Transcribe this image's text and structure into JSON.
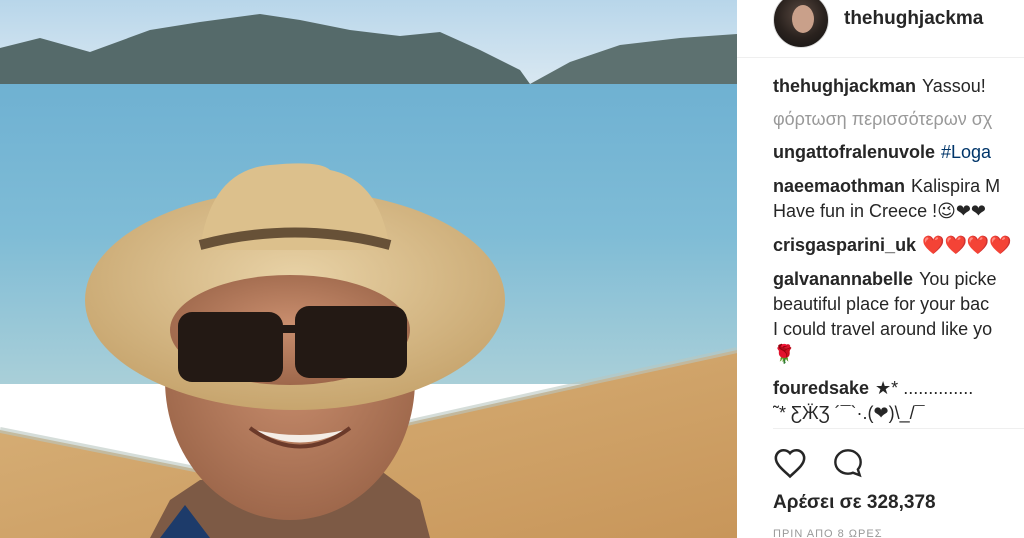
{
  "post": {
    "username": "thehughjackma",
    "photo_description_icon": "selfie-photo"
  },
  "caption": {
    "user": "thehughjackman",
    "text": "Yassou!"
  },
  "load_more": "φόρτωση περισσότερων σχ",
  "comments": [
    {
      "user": "ungattofralenuvole",
      "text": "#Loga"
    },
    {
      "user": "naeemaothman",
      "text": "Kalispira M",
      "line2": "Have fun in Creece !😉❤❤"
    },
    {
      "user": "crisgasparini_uk",
      "text": "❤️❤️❤️❤️"
    },
    {
      "user": "galvanannabelle",
      "text": "You picke",
      "line2": "beautiful place for your bac",
      "line3": "I could travel around like yo",
      "line4": "🌹"
    },
    {
      "user": "fouredsake",
      "text": "★* ..............",
      "line2": "˜* ƸӜƷ ´¯`·.(❤)\\_/¯"
    }
  ],
  "actions": {
    "like_icon": "heart-icon",
    "comment_icon": "comment-bubble-icon"
  },
  "likes_text": "Αρέσει σε 328,378",
  "timestamp": "ΠΡΙΝ ΑΠΟ 8 ΩΡΕΣ",
  "colors": {
    "link": "#003569",
    "muted": "#999999",
    "text": "#262626"
  }
}
